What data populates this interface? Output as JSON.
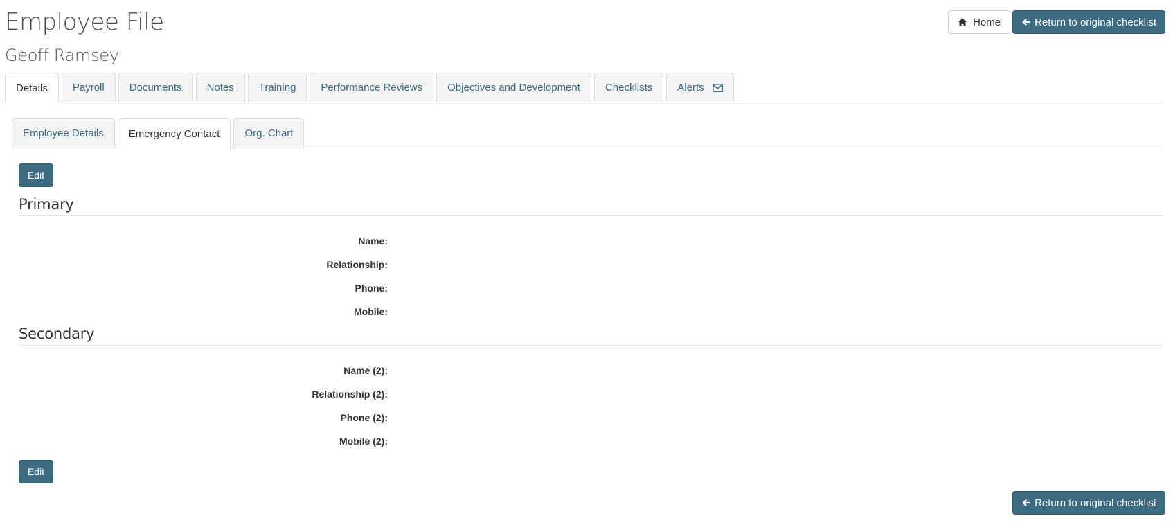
{
  "header": {
    "title": "Employee File",
    "employee_name": "Geoff Ramsey",
    "home_label": "Home",
    "return_label": "Return to original checklist"
  },
  "tabs": [
    {
      "label": "Details",
      "active": true
    },
    {
      "label": "Payroll"
    },
    {
      "label": "Documents"
    },
    {
      "label": "Notes"
    },
    {
      "label": "Training"
    },
    {
      "label": "Performance Reviews"
    },
    {
      "label": "Objectives and Development"
    },
    {
      "label": "Checklists"
    },
    {
      "label": "Alerts",
      "icon": "envelope-icon"
    }
  ],
  "subtabs": [
    {
      "label": "Employee Details"
    },
    {
      "label": "Emergency Contact",
      "active": true
    },
    {
      "label": "Org. Chart"
    }
  ],
  "content": {
    "edit_label": "Edit",
    "primary": {
      "title": "Primary",
      "fields": [
        "Name:",
        "Relationship:",
        "Phone:",
        "Mobile:"
      ]
    },
    "secondary": {
      "title": "Secondary",
      "fields": [
        "Name (2):",
        "Relationship (2):",
        "Phone (2):",
        "Mobile (2):"
      ]
    }
  },
  "colors": {
    "primary_button": "#3d6b82",
    "tab_link": "#3a6b82"
  }
}
